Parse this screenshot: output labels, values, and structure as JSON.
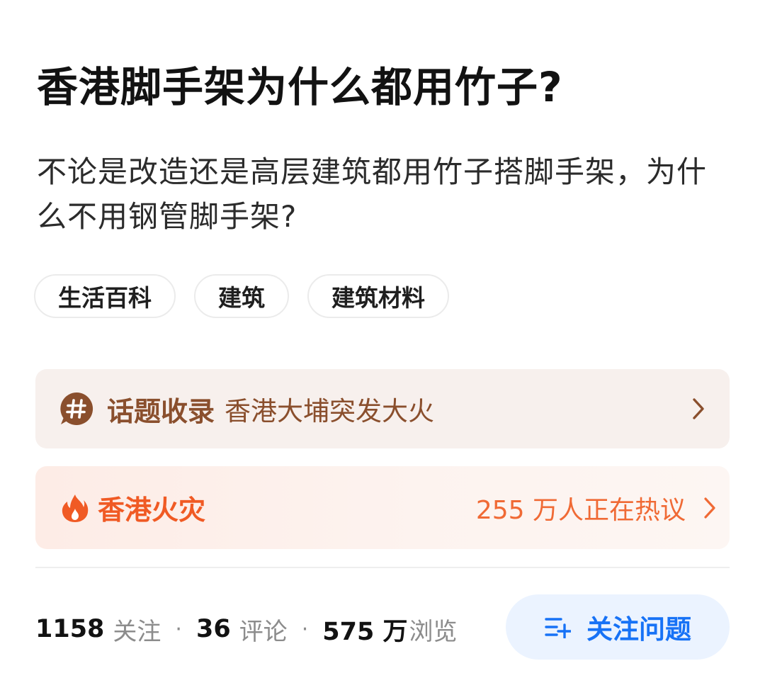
{
  "question": {
    "title": "香港脚手架为什么都用竹子?",
    "description": "不论是改造还是高层建筑都用竹子搭脚手架，为什么不用钢管脚手架?"
  },
  "tags": [
    "生活百科",
    "建筑",
    "建筑材料"
  ],
  "topic_card": {
    "icon": "hashtag-bubble-icon",
    "label": "话题收录",
    "topic": "香港大埔突发大火"
  },
  "hot_card": {
    "icon": "fire-icon",
    "title": "香港火灾",
    "count_text": "255 万人正在热议"
  },
  "stats": {
    "followers": "1158",
    "followers_label": "关注",
    "comments": "36",
    "comments_label": "评论",
    "views": "575 万",
    "views_label": "浏览",
    "separator": "·"
  },
  "follow_button": {
    "icon": "follow-list-plus-icon",
    "label": "关注问题"
  },
  "colors": {
    "topic_bg": "#f7f0ed",
    "topic_text": "#8a4f2d",
    "hot_text": "#f05a24",
    "button_bg": "#ebf3ff",
    "button_text": "#1772f6"
  }
}
